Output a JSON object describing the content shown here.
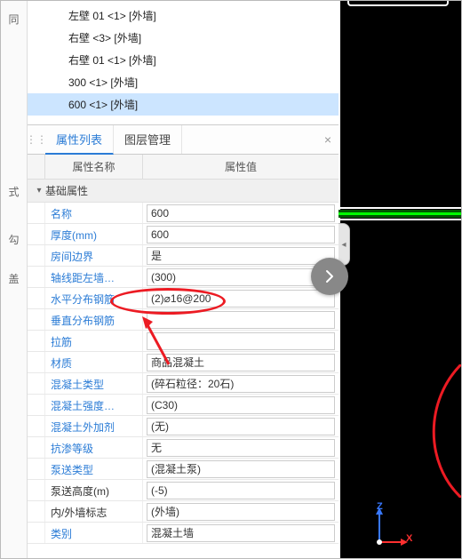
{
  "leftStrip": {
    "items": [
      "同",
      "式",
      "勾",
      "盖"
    ]
  },
  "tree": {
    "items": [
      {
        "label": "左壁 01 <1> [外墙]",
        "selected": false
      },
      {
        "label": "右壁 <3> [外墙]",
        "selected": false
      },
      {
        "label": "右壁 01 <1> [外墙]",
        "selected": false
      },
      {
        "label": "300 <1> [外墙]",
        "selected": false
      },
      {
        "label": "600 <1> [外墙]",
        "selected": true
      }
    ]
  },
  "tabs": {
    "items": [
      "属性列表",
      "图层管理"
    ],
    "activeIndex": 0
  },
  "panelClose": "×",
  "gridHeader": {
    "name": "属性名称",
    "value": "属性值"
  },
  "group": {
    "label": "基础属性",
    "toggle": "▾"
  },
  "props": [
    {
      "name": "名称",
      "value": "600",
      "link": true
    },
    {
      "name": "厚度(mm)",
      "value": "600",
      "link": true
    },
    {
      "name": "房间边界",
      "value": "是",
      "link": true
    },
    {
      "name": "轴线距左墙…",
      "value": "(300)",
      "link": true
    },
    {
      "name": "水平分布钢筋",
      "value": "(2)⌀16@200",
      "link": true
    },
    {
      "name": "垂直分布钢筋",
      "value": "",
      "link": true
    },
    {
      "name": "拉筋",
      "value": "",
      "link": true
    },
    {
      "name": "材质",
      "value": "商品混凝土",
      "link": true
    },
    {
      "name": "混凝土类型",
      "value": "(碎石粒径：20石)",
      "link": true
    },
    {
      "name": "混凝土强度…",
      "value": "(C30)",
      "link": true
    },
    {
      "name": "混凝土外加剂",
      "value": "(无)",
      "link": true
    },
    {
      "name": "抗渗等级",
      "value": "无",
      "link": true
    },
    {
      "name": "泵送类型",
      "value": "(混凝土泵)",
      "link": true
    },
    {
      "name": "泵送高度(m)",
      "value": "(-5)",
      "link": false
    },
    {
      "name": "内/外墙标志",
      "value": "(外墙)",
      "link": false
    },
    {
      "name": "类别",
      "value": "混凝土墙",
      "link": true
    }
  ],
  "axis": {
    "z": "Z",
    "x": "X"
  },
  "collapseHint": "◂"
}
